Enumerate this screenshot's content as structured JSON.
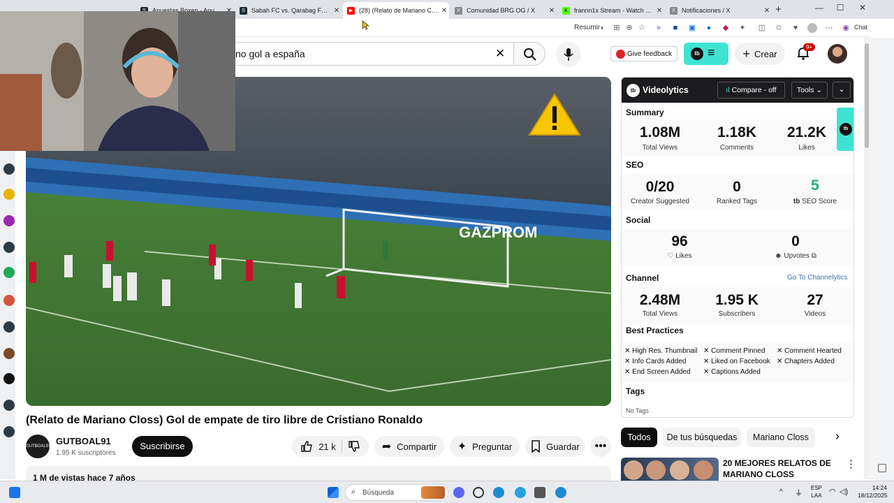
{
  "browser": {
    "tabs": [
      {
        "title": "Apuestas Boxeo - Apuesta e",
        "icon": "stake-icon",
        "active": false
      },
      {
        "title": "Sabah FC vs. Qarabag FK - Stake",
        "icon": "stake-icon",
        "active": false
      },
      {
        "title": "(28) (Relato de Mariano Closs) Go",
        "icon": "youtube-icon",
        "active": true
      },
      {
        "title": "Comunidad BRG OG / X",
        "icon": "x-icon",
        "active": false
      },
      {
        "title": "frannn1x Stream - Watch Live on",
        "icon": "kick-icon",
        "active": false
      },
      {
        "title": "Notificaciones / X",
        "icon": "x-icon",
        "active": false
      }
    ],
    "toolbar": {
      "resumir_label": "Resumir",
      "chat_label": "Chat"
    }
  },
  "youtube": {
    "search_value": "no gol a españa",
    "feedback_label": "Give feedback",
    "create_label": "Crear",
    "notification_badge": "9+",
    "video_title": "(Relato de Mariano Closs) Gol de empate de tiro libre de Cristiano Ronaldo",
    "channel": {
      "name": "GUTBOAL91",
      "subscribers": "1.95 K suscriptores",
      "avatar_text": "GUTBOAL91"
    },
    "subscribe_label": "Suscribirse",
    "likes": "21 k",
    "share_label": "Compartir",
    "ask_label": "Preguntar",
    "save_label": "Guardar",
    "description_partial": "1 M de vistas  hace 7 años",
    "chips": [
      "Todos",
      "De tus búsquedas",
      "Mariano Closs"
    ],
    "recommended": {
      "title": "20 MEJORES RELATOS DE MARIANO CLOSS"
    }
  },
  "videolytics": {
    "brand": "Videolytics",
    "compare_label": "Compare - off",
    "tools_label": "Tools",
    "summary": {
      "heading": "Summary",
      "stats": [
        {
          "value": "1.08M",
          "label": "Total Views"
        },
        {
          "value": "1.18K",
          "label": "Comments"
        },
        {
          "value": "21.2K",
          "label": "Likes"
        }
      ]
    },
    "seo": {
      "heading": "SEO",
      "stats": [
        {
          "value": "0/20",
          "label": "Creator Suggested"
        },
        {
          "value": "0",
          "label": "Ranked Tags"
        },
        {
          "value": "5",
          "label": "SEO Score"
        }
      ]
    },
    "social": {
      "heading": "Social",
      "stats": [
        {
          "value": "96",
          "label": "Likes"
        },
        {
          "value": "0",
          "label": "Upvotes"
        }
      ]
    },
    "channel": {
      "heading": "Channel",
      "link": "Go To Channelytics",
      "stats": [
        {
          "value": "2.48M",
          "label": "Total Views"
        },
        {
          "value": "1.95 K",
          "label": "Subscribers"
        },
        {
          "value": "27",
          "label": "Videos"
        }
      ]
    },
    "best_practices": {
      "heading": "Best Practices",
      "items": [
        "High Res. Thumbnail",
        "Comment Pinned",
        "Comment Hearted",
        "Info Cards Added",
        "Liked on Facebook",
        "Chapters Added",
        "End Screen Added",
        "Captions Added"
      ]
    },
    "tags": {
      "heading": "Tags",
      "empty": "No Tags"
    }
  },
  "taskbar": {
    "search_label": "Búsqueda",
    "lang": "ESP",
    "lang2": "LAA",
    "time": "14:24",
    "date": "18/12/2025"
  },
  "colors": {
    "accent": "#3ee3d2",
    "youtube_red": "#ff0000",
    "seo_green": "#1fae7a",
    "link_blue": "#3a6fb0"
  }
}
